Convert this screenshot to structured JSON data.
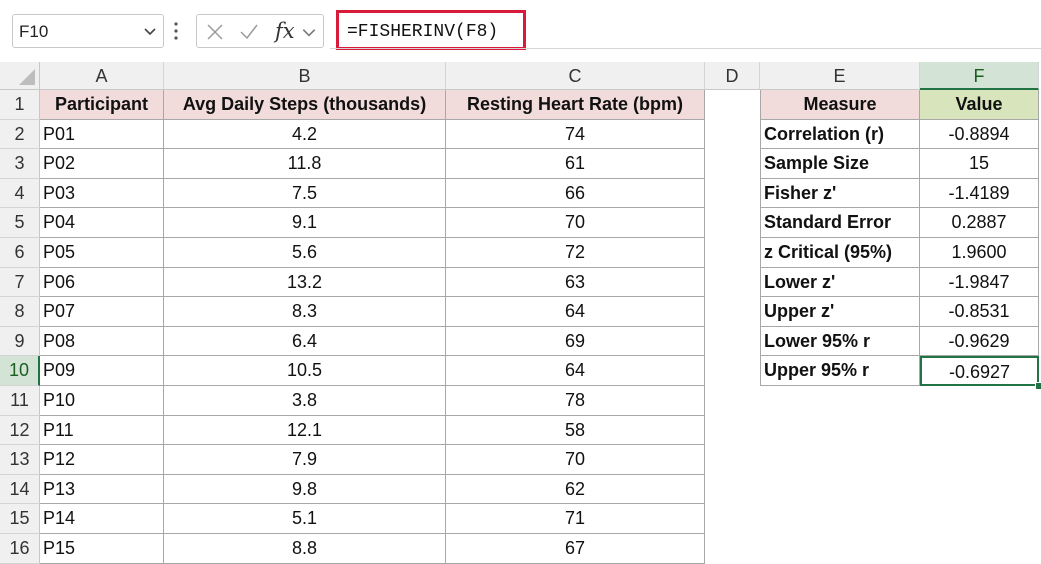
{
  "formula_bar": {
    "name_box": "F10",
    "fx_label": "fx",
    "formula": "=FISHERINV(F8)"
  },
  "columns": [
    "A",
    "B",
    "C",
    "D",
    "E",
    "F"
  ],
  "rows": [
    "1",
    "2",
    "3",
    "4",
    "5",
    "6",
    "7",
    "8",
    "9",
    "10",
    "11",
    "12",
    "13",
    "14",
    "15",
    "16"
  ],
  "table": {
    "headers": [
      "Participant",
      "Avg Daily Steps (thousands)",
      "Resting Heart Rate (bpm)"
    ],
    "rows": [
      [
        "P01",
        "4.2",
        "74"
      ],
      [
        "P02",
        "11.8",
        "61"
      ],
      [
        "P03",
        "7.5",
        "66"
      ],
      [
        "P04",
        "9.1",
        "70"
      ],
      [
        "P05",
        "5.6",
        "72"
      ],
      [
        "P06",
        "13.2",
        "63"
      ],
      [
        "P07",
        "8.3",
        "64"
      ],
      [
        "P08",
        "6.4",
        "69"
      ],
      [
        "P09",
        "10.5",
        "64"
      ],
      [
        "P10",
        "3.8",
        "78"
      ],
      [
        "P11",
        "12.1",
        "58"
      ],
      [
        "P12",
        "7.9",
        "70"
      ],
      [
        "P13",
        "9.8",
        "62"
      ],
      [
        "P14",
        "5.1",
        "71"
      ],
      [
        "P15",
        "8.8",
        "67"
      ]
    ]
  },
  "summary": {
    "headers": [
      "Measure",
      "Value"
    ],
    "rows": [
      [
        "Correlation (r)",
        "-0.8894"
      ],
      [
        "Sample Size",
        "15"
      ],
      [
        "Fisher z'",
        "-1.4189"
      ],
      [
        "Standard Error",
        "0.2887"
      ],
      [
        "z Critical (95%)",
        "1.9600"
      ],
      [
        "Lower z'",
        "-1.9847"
      ],
      [
        "Upper z'",
        "-0.8531"
      ],
      [
        "Lower 95% r",
        "-0.9629"
      ],
      [
        "Upper 95% r",
        "-0.6927"
      ]
    ]
  },
  "selection": {
    "cell": "F10",
    "column": "F",
    "row": "10"
  },
  "colors": {
    "header_pink": "#f2dcdb",
    "header_green": "#d8e4bc",
    "selection": "#217346",
    "formula_highlight": "#d81b3b"
  }
}
